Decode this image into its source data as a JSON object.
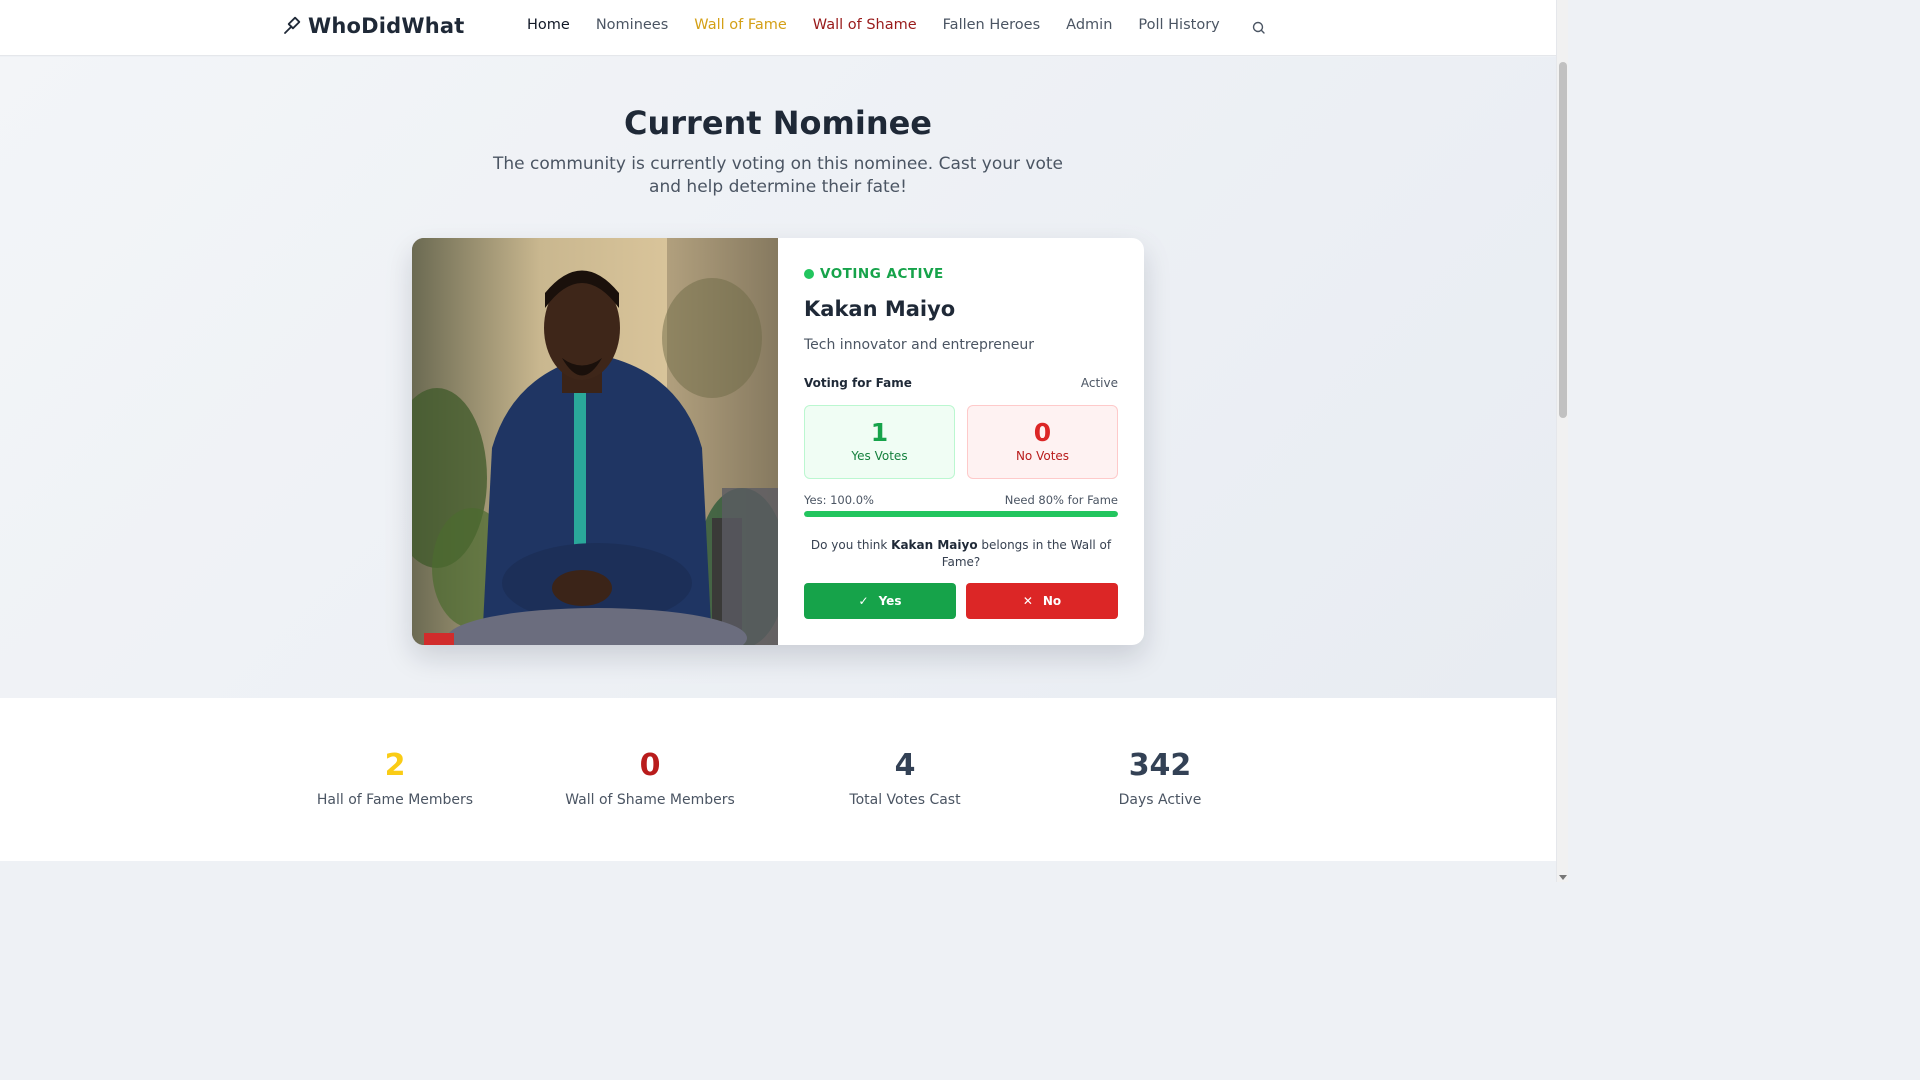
{
  "header": {
    "brand": "WhoDidWhat",
    "nav": [
      "Home",
      "Nominees",
      "Wall of Fame",
      "Wall of Shame",
      "Fallen Heroes",
      "Admin",
      "Poll History"
    ],
    "active_nav": "Home"
  },
  "hero": {
    "title": "Current Nominee",
    "subtitle": "The community is currently voting on this nominee. Cast your vote and help determine their fate!"
  },
  "nominee": {
    "status": "VOTING ACTIVE",
    "name": "Kakan Maiyo",
    "description": "Tech innovator and entrepreneur",
    "voting_type": "Voting for Fame",
    "voting_state": "Active",
    "yes_count": "1",
    "yes_label": "Yes Votes",
    "no_count": "0",
    "no_label": "No Votes",
    "yes_percent_text": "Yes: 100.0%",
    "yes_percent": 100,
    "threshold_text": "Need 80% for Fame",
    "question_prefix": "Do you think ",
    "question_suffix": " belongs in the Wall of Fame?",
    "yes_button": "Yes",
    "no_button": "No"
  },
  "stats": [
    {
      "value": "2",
      "label": "Hall of Fame Members",
      "color": "#facc15"
    },
    {
      "value": "0",
      "label": "Wall of Shame Members",
      "color": "#b91c1c"
    },
    {
      "value": "4",
      "label": "Total Votes Cast",
      "color": "#334155"
    },
    {
      "value": "342",
      "label": "Days Active",
      "color": "#334155"
    }
  ],
  "colors": {
    "fame": "#d4a017",
    "shame": "#991b1b",
    "yes": "#16a34a",
    "no": "#dc2626"
  },
  "icons": {
    "brand": "gavel-icon",
    "search": "search-icon",
    "yes": "check-icon",
    "no": "x-icon"
  }
}
